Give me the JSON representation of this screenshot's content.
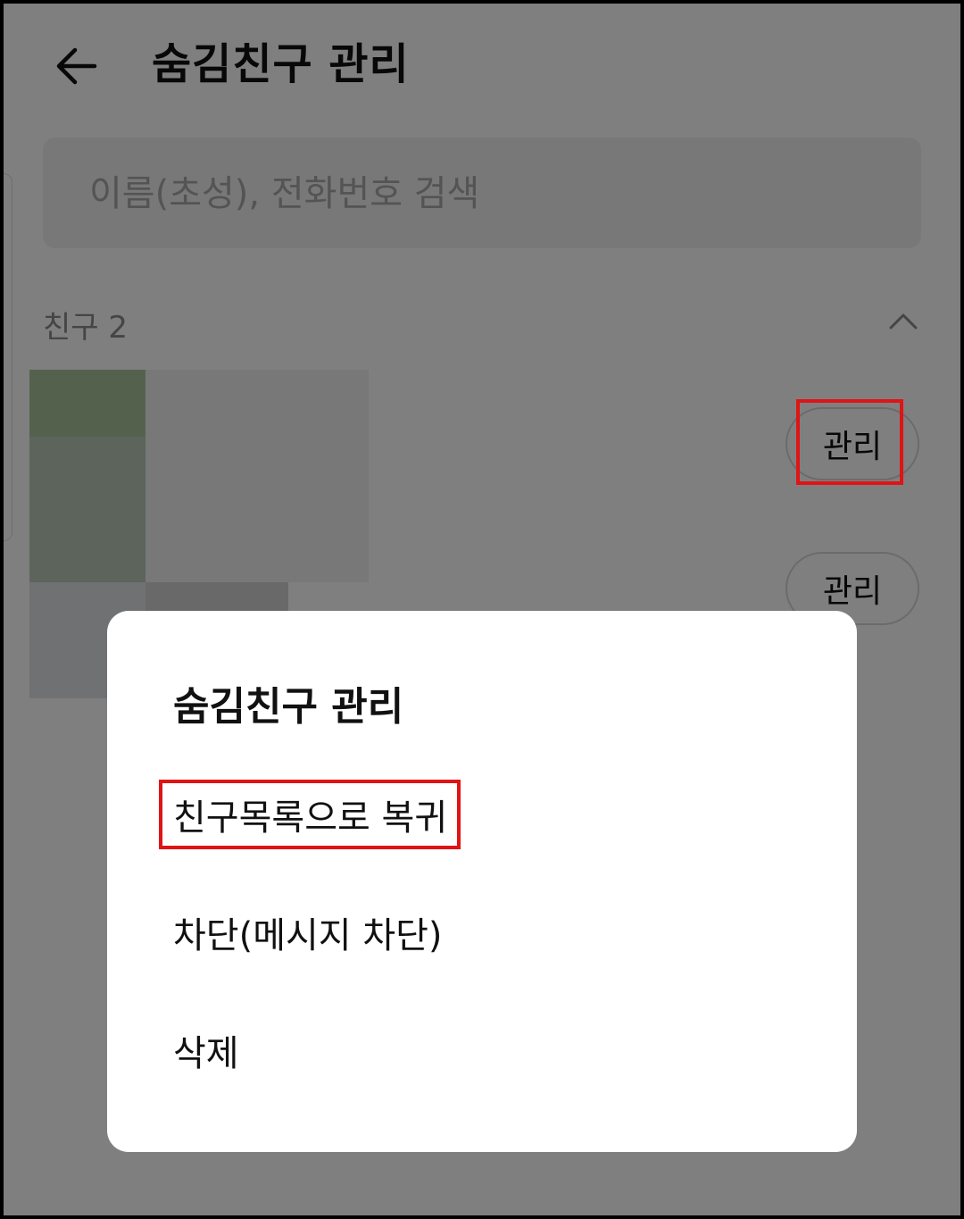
{
  "header": {
    "back_icon": "arrow-left-icon",
    "title": "숨김친구 관리"
  },
  "search": {
    "placeholder": "이름(초성), 전화번호 검색",
    "value": ""
  },
  "friends_section": {
    "label": "친구 2",
    "collapse_icon": "chevron-up-icon",
    "rows": [
      {
        "manage_label": "관리"
      },
      {
        "manage_label": "관리"
      }
    ]
  },
  "dialog": {
    "title": "숨김친구 관리",
    "items": [
      {
        "label": "친구목록으로 복귀"
      },
      {
        "label": "차단(메시지 차단)"
      },
      {
        "label": "삭제"
      }
    ]
  },
  "annotations": {
    "highlight_color": "#e01414"
  },
  "colors": {
    "overlay": "rgba(0,0,0,0.5)",
    "search_bg": "#f0f0f0",
    "dialog_bg": "#ffffff"
  }
}
